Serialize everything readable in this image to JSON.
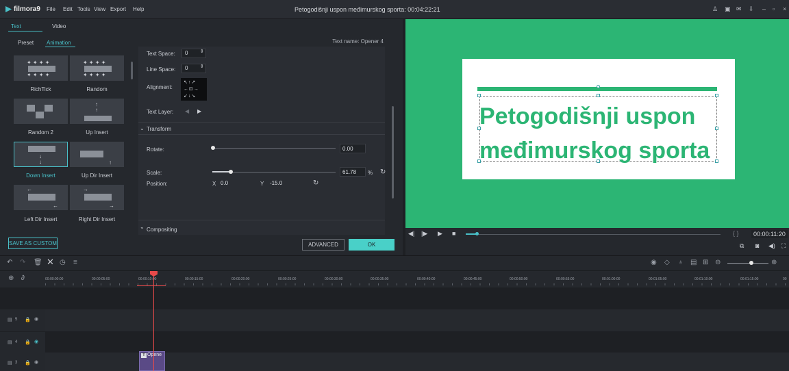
{
  "app": {
    "name": "filmora9",
    "title": "Petogodišnji uspon međimurskog sporta: 00:04:22:21"
  },
  "menu": [
    "File",
    "Edit",
    "Tools",
    "View",
    "Export",
    "Help"
  ],
  "panel": {
    "tab_text": "Text",
    "tab_video": "Video",
    "sub_preset": "Preset",
    "sub_animation": "Animation",
    "text_name": "Text name: Opener 4"
  },
  "animations": [
    {
      "label": "RichTick",
      "selected": false
    },
    {
      "label": "Random",
      "selected": false
    },
    {
      "label": "Random 2",
      "selected": false
    },
    {
      "label": "Up Insert",
      "selected": false
    },
    {
      "label": "Down Insert",
      "selected": true
    },
    {
      "label": "Up Dir Insert",
      "selected": false
    },
    {
      "label": "Left Dir Insert",
      "selected": false
    },
    {
      "label": "Right Dir Insert",
      "selected": false
    }
  ],
  "settings": {
    "text_space_label": "Text Space:",
    "text_space_value": "0",
    "line_space_label": "Line Space:",
    "line_space_value": "0",
    "alignment_label": "Alignment:",
    "text_layer_label": "Text Layer:",
    "transform_header": "Transform",
    "rotate_label": "Rotate:",
    "rotate_value": "0.00",
    "scale_label": "Scale:",
    "scale_value": "61.78",
    "scale_unit": "%",
    "position_label": "Position:",
    "pos_x_label": "X",
    "pos_x_value": "0.0",
    "pos_y_label": "Y",
    "pos_y_value": "-15.0",
    "compositing_header": "Compositing"
  },
  "buttons": {
    "save_custom": "SAVE AS CUSTOM",
    "advanced": "ADVANCED",
    "ok": "OK"
  },
  "preview": {
    "line1": "Petogodišnji uspon",
    "line2": "međimurskog sporta",
    "timecode": "00:00:11:20",
    "playback_progress": 0.04
  },
  "ruler": [
    "00:00:00:00",
    "00:00:05:00",
    "00:00:10:00",
    "00:00:15:00",
    "00:00:20:00",
    "00:00:25:00",
    "00:00:30:00",
    "00:00:35:00",
    "00:00:40:00",
    "00:00:45:00",
    "00:00:50:00",
    "00:00:55:00",
    "00:01:00:00",
    "00:01:05:00",
    "00:01:10:00",
    "00:01:15:00",
    "00"
  ],
  "tracks": [
    {
      "label": "5"
    },
    {
      "label": "4"
    },
    {
      "label": "3"
    }
  ],
  "clip": {
    "label": "Opene"
  },
  "colors": {
    "accent": "#49c0c8",
    "preview_bg": "#2cb574",
    "playhead": "#e84a4a"
  }
}
